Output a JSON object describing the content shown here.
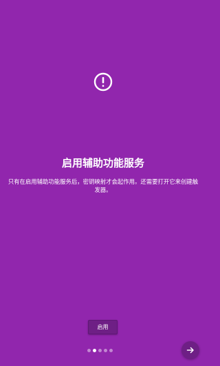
{
  "theme": {
    "background": "#9126AD",
    "button_background": "#6E1F85"
  },
  "page": {
    "icon": "alert-circle-icon",
    "title": "启用辅助功能服务",
    "description": "只有在启用辅助功能服务后，密钥映射才会起作用。还需要打开它来创建触发器。"
  },
  "actions": {
    "enable_label": "启用",
    "next_icon": "arrow-right-icon"
  },
  "pager": {
    "total": 5,
    "current": 2
  }
}
